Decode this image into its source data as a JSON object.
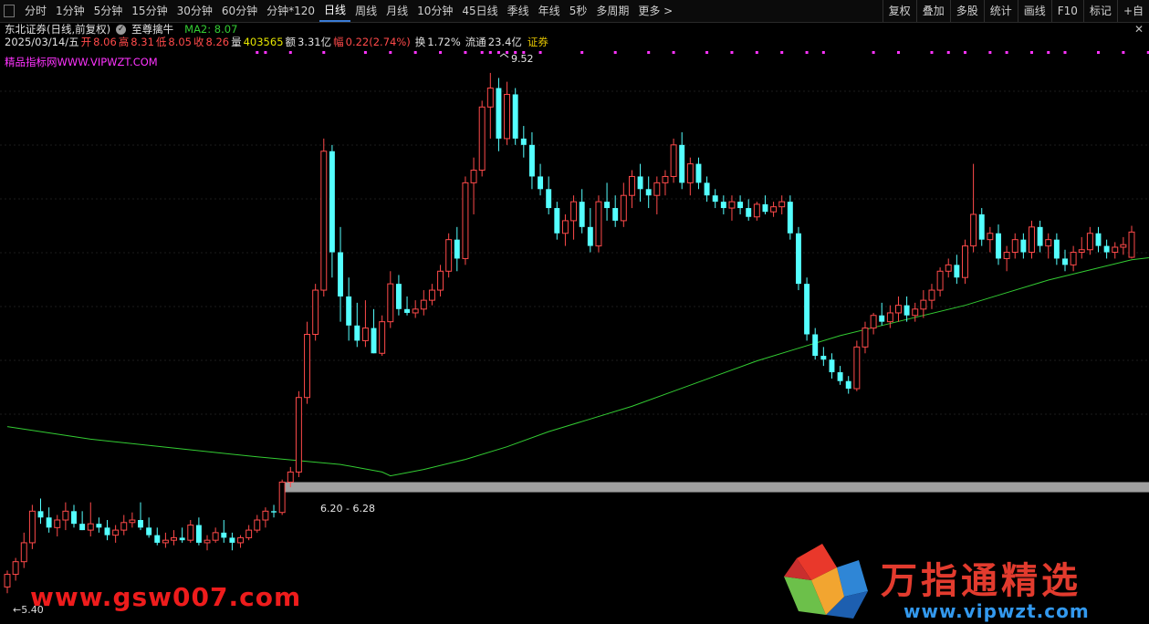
{
  "toolbar": {
    "periods": [
      "分时",
      "1分钟",
      "5分钟",
      "15分钟",
      "30分钟",
      "60分钟",
      "分钟*120",
      "日线",
      "周线",
      "月线",
      "10分钟",
      "45日线",
      "季线",
      "年线",
      "5秒",
      "多周期",
      "更多 >"
    ],
    "active": "日线",
    "right_tools": [
      "复权",
      "叠加",
      "多股",
      "统计",
      "画线",
      "F10",
      "标记",
      "+自"
    ]
  },
  "info": {
    "stock_name": "东北证券(日线,前复权)",
    "indicator_name": "至尊擒牛",
    "ma_label": "MA2: 8.07",
    "close_icon": "x-icon",
    "date": "2025/03/14/五",
    "open_label": "开",
    "open_value": "8.06",
    "high_label": "高",
    "high_value": "8.31",
    "low_label": "低",
    "low_value": "8.05",
    "close_label": "收",
    "close_value": "8.26",
    "volume_label": "量",
    "volume_value": "403565",
    "amount_label": "额",
    "amount_value": "3.31亿",
    "range_label": "幅",
    "range_value": "0.22(2.74%)",
    "turnover_label": "换",
    "turnover_value": "1.72%",
    "float_label": "流通",
    "float_value": "23.4亿",
    "sector": "证券"
  },
  "watermark_text": "精品指标网WWW.VIPWZT.COM",
  "annotations": {
    "peak": "9.52",
    "low": "5.40",
    "band": "6.20 - 6.28"
  },
  "brand": {
    "title": "万指通精选",
    "url": "www.vipwzt.com",
    "bottom_left": "www.gsw007.com"
  },
  "colors": {
    "up": "#ff4a4a",
    "down": "#54ffff",
    "ma": "#33cc33",
    "band": "#a0a0a0",
    "marker": "#ff33ff",
    "active_tab": "#3a7bd5"
  },
  "chart_data": {
    "type": "candlestick",
    "ylim": [
      5.2,
      9.7
    ],
    "band": [
      6.2,
      6.28
    ],
    "ma_label": "MA2",
    "candles": [
      [
        5.45,
        5.58,
        5.4,
        5.55
      ],
      [
        5.55,
        5.68,
        5.5,
        5.65
      ],
      [
        5.65,
        5.88,
        5.6,
        5.8
      ],
      [
        5.8,
        6.1,
        5.75,
        6.05
      ],
      [
        6.05,
        6.15,
        5.95,
        6.0
      ],
      [
        6.0,
        6.08,
        5.88,
        5.92
      ],
      [
        5.92,
        6.02,
        5.85,
        5.98
      ],
      [
        5.98,
        6.12,
        5.9,
        6.05
      ],
      [
        6.05,
        6.1,
        5.92,
        5.95
      ],
      [
        5.95,
        6.05,
        5.9,
        5.9
      ],
      [
        5.9,
        6.12,
        5.85,
        5.95
      ],
      [
        5.95,
        6.0,
        5.88,
        5.92
      ],
      [
        5.92,
        5.98,
        5.82,
        5.86
      ],
      [
        5.86,
        5.94,
        5.8,
        5.9
      ],
      [
        5.9,
        6.02,
        5.86,
        5.96
      ],
      [
        5.96,
        6.04,
        5.92,
        5.98
      ],
      [
        5.98,
        6.12,
        5.9,
        5.92
      ],
      [
        5.92,
        6.0,
        5.84,
        5.86
      ],
      [
        5.86,
        5.92,
        5.78,
        5.8
      ],
      [
        5.8,
        5.88,
        5.76,
        5.82
      ],
      [
        5.82,
        5.9,
        5.78,
        5.84
      ],
      [
        5.84,
        5.92,
        5.8,
        5.82
      ],
      [
        5.82,
        5.98,
        5.8,
        5.94
      ],
      [
        5.94,
        6.0,
        5.78,
        5.8
      ],
      [
        5.8,
        5.86,
        5.74,
        5.82
      ],
      [
        5.82,
        5.92,
        5.8,
        5.88
      ],
      [
        5.88,
        5.98,
        5.8,
        5.84
      ],
      [
        5.84,
        5.88,
        5.74,
        5.8
      ],
      [
        5.8,
        5.86,
        5.76,
        5.84
      ],
      [
        5.84,
        5.94,
        5.82,
        5.9
      ],
      [
        5.9,
        6.02,
        5.88,
        5.98
      ],
      [
        5.98,
        6.08,
        5.92,
        6.05
      ],
      [
        6.05,
        6.1,
        6.0,
        6.04
      ],
      [
        6.04,
        6.3,
        6.02,
        6.28
      ],
      [
        6.28,
        6.4,
        6.24,
        6.36
      ],
      [
        6.36,
        7.0,
        6.32,
        6.95
      ],
      [
        6.95,
        7.55,
        6.9,
        7.45
      ],
      [
        7.45,
        7.85,
        7.4,
        7.8
      ],
      [
        7.8,
        9.0,
        7.75,
        8.9
      ],
      [
        8.9,
        8.95,
        7.9,
        8.1
      ],
      [
        8.1,
        8.3,
        7.55,
        7.75
      ],
      [
        7.75,
        7.9,
        7.4,
        7.52
      ],
      [
        7.52,
        7.7,
        7.35,
        7.4
      ],
      [
        7.4,
        7.72,
        7.35,
        7.5
      ],
      [
        7.5,
        7.65,
        7.3,
        7.3
      ],
      [
        7.3,
        7.6,
        7.28,
        7.55
      ],
      [
        7.55,
        7.95,
        7.5,
        7.85
      ],
      [
        7.85,
        7.92,
        7.6,
        7.65
      ],
      [
        7.65,
        7.75,
        7.6,
        7.62
      ],
      [
        7.62,
        7.72,
        7.58,
        7.65
      ],
      [
        7.65,
        7.8,
        7.6,
        7.72
      ],
      [
        7.72,
        7.85,
        7.68,
        7.8
      ],
      [
        7.8,
        8.0,
        7.75,
        7.95
      ],
      [
        7.95,
        8.25,
        7.9,
        8.2
      ],
      [
        8.2,
        8.3,
        7.95,
        8.05
      ],
      [
        8.05,
        8.7,
        8.0,
        8.65
      ],
      [
        8.65,
        8.85,
        8.4,
        8.75
      ],
      [
        8.75,
        9.3,
        8.7,
        9.25
      ],
      [
        9.25,
        9.52,
        9.0,
        9.4
      ],
      [
        9.4,
        9.48,
        8.9,
        9.0
      ],
      [
        9.0,
        9.45,
        8.95,
        9.35
      ],
      [
        9.35,
        9.4,
        8.95,
        9.0
      ],
      [
        9.0,
        9.1,
        8.85,
        8.95
      ],
      [
        8.95,
        9.05,
        8.6,
        8.7
      ],
      [
        8.7,
        8.8,
        8.55,
        8.6
      ],
      [
        8.6,
        8.7,
        8.4,
        8.45
      ],
      [
        8.45,
        8.5,
        8.2,
        8.25
      ],
      [
        8.25,
        8.4,
        8.15,
        8.35
      ],
      [
        8.35,
        8.55,
        8.2,
        8.5
      ],
      [
        8.5,
        8.6,
        8.25,
        8.3
      ],
      [
        8.3,
        8.45,
        8.1,
        8.15
      ],
      [
        8.15,
        8.55,
        8.1,
        8.5
      ],
      [
        8.5,
        8.65,
        8.35,
        8.45
      ],
      [
        8.45,
        8.55,
        8.3,
        8.35
      ],
      [
        8.35,
        8.65,
        8.3,
        8.55
      ],
      [
        8.55,
        8.75,
        8.45,
        8.7
      ],
      [
        8.7,
        8.8,
        8.5,
        8.6
      ],
      [
        8.6,
        8.7,
        8.45,
        8.55
      ],
      [
        8.55,
        8.7,
        8.4,
        8.65
      ],
      [
        8.65,
        8.75,
        8.55,
        8.7
      ],
      [
        8.7,
        9.0,
        8.65,
        8.95
      ],
      [
        8.95,
        9.05,
        8.6,
        8.65
      ],
      [
        8.65,
        8.85,
        8.55,
        8.8
      ],
      [
        8.8,
        8.85,
        8.6,
        8.65
      ],
      [
        8.65,
        8.7,
        8.5,
        8.55
      ],
      [
        8.55,
        8.6,
        8.45,
        8.5
      ],
      [
        8.5,
        8.55,
        8.4,
        8.45
      ],
      [
        8.45,
        8.55,
        8.35,
        8.5
      ],
      [
        8.5,
        8.55,
        8.4,
        8.45
      ],
      [
        8.45,
        8.52,
        8.35,
        8.38
      ],
      [
        8.38,
        8.5,
        8.35,
        8.48
      ],
      [
        8.48,
        8.55,
        8.4,
        8.42
      ],
      [
        8.42,
        8.5,
        8.38,
        8.46
      ],
      [
        8.46,
        8.55,
        8.4,
        8.5
      ],
      [
        8.5,
        8.55,
        8.2,
        8.25
      ],
      [
        8.25,
        8.3,
        7.8,
        7.85
      ],
      [
        7.85,
        7.9,
        7.4,
        7.45
      ],
      [
        7.45,
        7.5,
        7.25,
        7.28
      ],
      [
        7.28,
        7.35,
        7.2,
        7.25
      ],
      [
        7.25,
        7.3,
        7.1,
        7.15
      ],
      [
        7.15,
        7.2,
        7.05,
        7.08
      ],
      [
        7.08,
        7.12,
        6.98,
        7.02
      ],
      [
        7.02,
        7.4,
        7.0,
        7.35
      ],
      [
        7.35,
        7.55,
        7.3,
        7.5
      ],
      [
        7.5,
        7.62,
        7.45,
        7.6
      ],
      [
        7.6,
        7.7,
        7.52,
        7.55
      ],
      [
        7.55,
        7.68,
        7.5,
        7.62
      ],
      [
        7.62,
        7.75,
        7.55,
        7.68
      ],
      [
        7.68,
        7.75,
        7.55,
        7.6
      ],
      [
        7.6,
        7.7,
        7.55,
        7.65
      ],
      [
        7.65,
        7.8,
        7.58,
        7.72
      ],
      [
        7.72,
        7.85,
        7.65,
        7.8
      ],
      [
        7.8,
        7.98,
        7.75,
        7.95
      ],
      [
        7.95,
        8.05,
        7.9,
        8.0
      ],
      [
        8.0,
        8.08,
        7.85,
        7.9
      ],
      [
        7.9,
        8.2,
        7.85,
        8.15
      ],
      [
        8.15,
        8.8,
        8.1,
        8.4
      ],
      [
        8.4,
        8.45,
        8.15,
        8.2
      ],
      [
        8.2,
        8.3,
        8.1,
        8.25
      ],
      [
        8.25,
        8.32,
        8.0,
        8.05
      ],
      [
        8.05,
        8.15,
        7.95,
        8.1
      ],
      [
        8.1,
        8.25,
        8.05,
        8.2
      ],
      [
        8.2,
        8.25,
        8.05,
        8.1
      ],
      [
        8.1,
        8.35,
        8.05,
        8.3
      ],
      [
        8.3,
        8.35,
        8.1,
        8.15
      ],
      [
        8.15,
        8.25,
        8.05,
        8.2
      ],
      [
        8.2,
        8.25,
        8.0,
        8.05
      ],
      [
        8.05,
        8.12,
        7.95,
        8.0
      ],
      [
        8.0,
        8.15,
        7.95,
        8.1
      ],
      [
        8.1,
        8.22,
        8.05,
        8.12
      ],
      [
        8.12,
        8.3,
        8.08,
        8.25
      ],
      [
        8.25,
        8.3,
        8.1,
        8.15
      ],
      [
        8.15,
        8.2,
        8.05,
        8.1
      ],
      [
        8.1,
        8.18,
        8.05,
        8.14
      ],
      [
        8.14,
        8.22,
        8.08,
        8.16
      ],
      [
        8.06,
        8.31,
        8.05,
        8.26
      ]
    ],
    "ma": [
      [
        0,
        6.72
      ],
      [
        10,
        6.62
      ],
      [
        20,
        6.55
      ],
      [
        30,
        6.48
      ],
      [
        40,
        6.42
      ],
      [
        45,
        6.36
      ],
      [
        46,
        6.33
      ],
      [
        50,
        6.38
      ],
      [
        55,
        6.46
      ],
      [
        60,
        6.56
      ],
      [
        65,
        6.68
      ],
      [
        70,
        6.78
      ],
      [
        75,
        6.88
      ],
      [
        80,
        7.0
      ],
      [
        85,
        7.12
      ],
      [
        90,
        7.24
      ],
      [
        95,
        7.34
      ],
      [
        100,
        7.44
      ],
      [
        105,
        7.52
      ],
      [
        110,
        7.6
      ],
      [
        115,
        7.68
      ],
      [
        120,
        7.78
      ],
      [
        125,
        7.88
      ],
      [
        130,
        7.96
      ],
      [
        135,
        8.04
      ],
      [
        140,
        8.08
      ],
      [
        144,
        8.1
      ],
      [
        149,
        8.12
      ]
    ]
  }
}
